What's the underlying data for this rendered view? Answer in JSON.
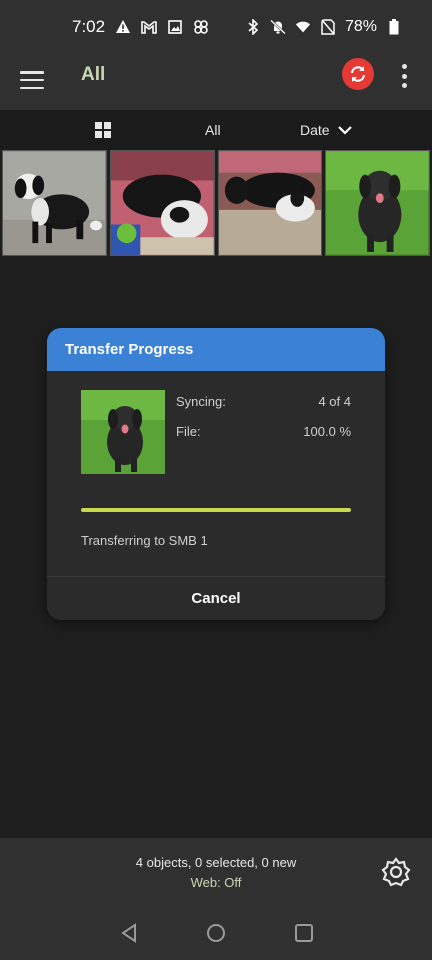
{
  "status_bar": {
    "time": "7:02",
    "battery": "78%",
    "left_icons": [
      "alert-icon",
      "gmail-icon",
      "image-icon",
      "pinwheel-icon"
    ],
    "right_icons": [
      "bluetooth-icon",
      "bell-off-icon",
      "wifi-icon",
      "no-sim-icon",
      "battery-icon"
    ]
  },
  "app_bar": {
    "title": "All",
    "sync_color": "#e53935"
  },
  "filter_bar": {
    "filter_label": "All",
    "sort_label": "Date"
  },
  "thumbnails": [
    {
      "name": "thumb-dog-1"
    },
    {
      "name": "thumb-dog-2"
    },
    {
      "name": "thumb-dog-3"
    },
    {
      "name": "thumb-dog-4"
    }
  ],
  "dialog": {
    "title": "Transfer Progress",
    "syncing_label": "Syncing:",
    "syncing_value": "4 of 4",
    "file_label": "File:",
    "file_value": "100.0 %",
    "progress": 1.0,
    "status_text": "Transferring to SMB 1",
    "cancel_label": "Cancel",
    "header_color": "#3b82d6",
    "progress_color": "#c6d94f"
  },
  "bottom_bar": {
    "info": "4 objects, 0 selected, 0 new",
    "web_status": "Web: Off"
  },
  "nav_bar": {
    "buttons": [
      "back-icon",
      "home-icon",
      "recents-icon"
    ]
  }
}
